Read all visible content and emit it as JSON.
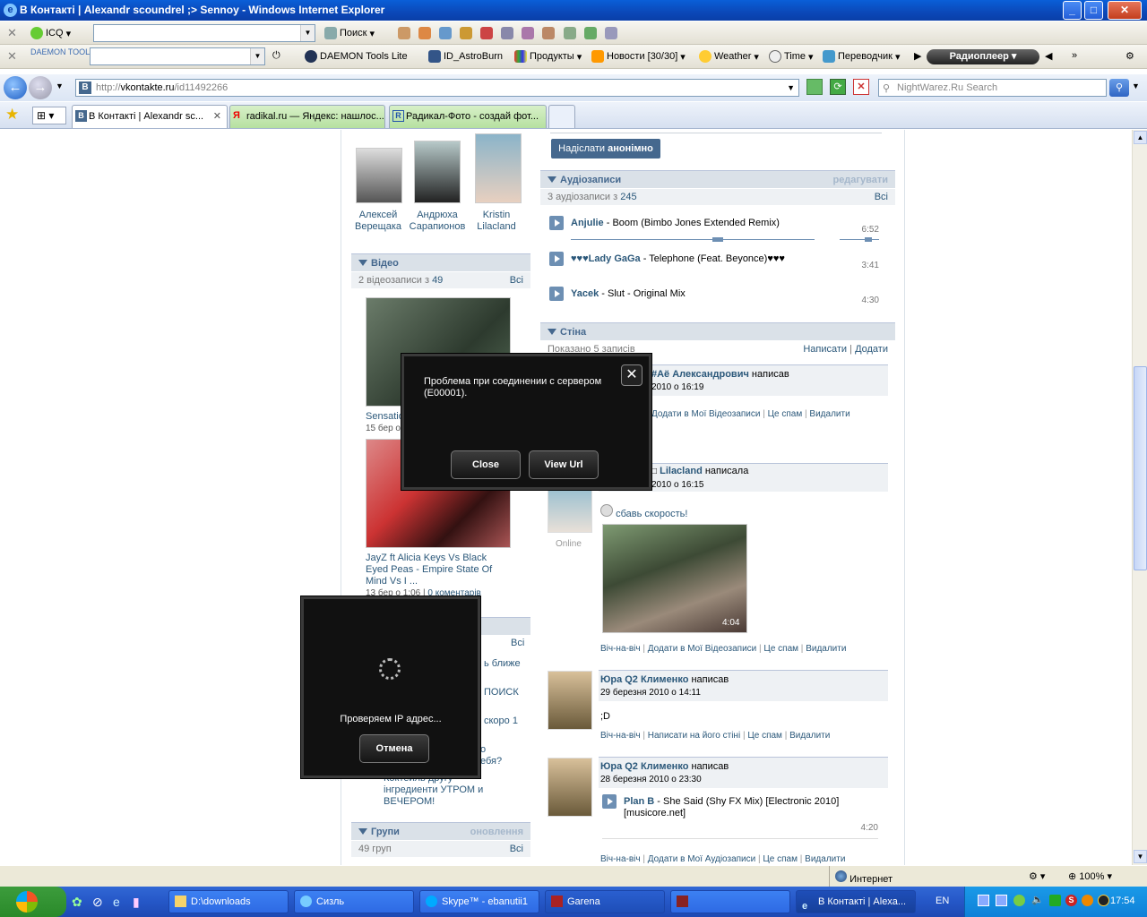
{
  "window": {
    "title": "В Контакті | Alexandr scoundrel ;> Sennoy - Windows Internet Explorer"
  },
  "toolbar1": {
    "icq": "ICQ",
    "search": "Поиск"
  },
  "toolbar2": {
    "daemon_logo": "DAEMON TOOLS",
    "items": [
      "DAEMON Tools Lite",
      "ID_AstroBurn",
      "Продукты",
      "Новости [30/30]",
      "Weather",
      "Time",
      "Переводчик"
    ],
    "radio": "Радиоплеер"
  },
  "address": {
    "url_prefix": "http://",
    "url_host": "vkontakte.ru",
    "url_path": "/id11492266",
    "search_placeholder": "NightWarez.Ru Search"
  },
  "tabs": [
    {
      "label": "В Контакті | Alexandr sc..."
    },
    {
      "label": "radikal.ru — Яндекс: нашлос..."
    },
    {
      "label": "Радикал-Фото - создай фот..."
    }
  ],
  "friends": [
    {
      "first": "Алексей",
      "last": "Верещака"
    },
    {
      "first": "Андрюха",
      "last": "Сарапионов"
    },
    {
      "first": "Kristin",
      "last": "Lilacland"
    }
  ],
  "video": {
    "header": "Відео",
    "count_text": "2 відеозаписи з",
    "count_total": "49",
    "all": "Всі",
    "item1_title_partial": "Sensatio",
    "item1_date_partial": "15 бер о",
    "item2_title": "JayZ ft Alicia Keys Vs Black Eyed Peas - Empire State Of Mind Vs I ...",
    "item2_date": "13 бер о 1:06",
    "item2_comments": "0 коментарів"
  },
  "left_lower": {
    "all": "Всі",
    "snippet1": "ь ближе",
    "snippet2": "ПОИСК",
    "snippet3": "скоро 1",
    "snippet4": "о",
    "snippet5": "ебя?",
    "snippet6": "Коктейль другу -",
    "snippet7": "інгредиенти УТРОМ и",
    "snippet8": "ВЕЧЕРОМ!"
  },
  "groups": {
    "header": "Групи",
    "updates": "оновлення",
    "count": "49 груп",
    "all": "Всі"
  },
  "anon_button": {
    "prefix": "Надіслати",
    "bold": "анонімно"
  },
  "audio": {
    "header": "Аудіозаписи",
    "edit": "редагувати",
    "count_text": "3 аудіозаписи з",
    "count_total": "245",
    "all": "Всі",
    "tracks": [
      {
        "artist": "Anjulie",
        "title": "- Boom (Bimbo Jones Extended Remix)",
        "duration": "6:52"
      },
      {
        "artist": "♥♥♥Lady GaGa",
        "title": "- Telephone (Feat. Beyonce)♥♥♥",
        "duration": "3:41"
      },
      {
        "artist": "Yacek",
        "title": "- Slut - Original Mix",
        "duration": "4:30"
      }
    ]
  },
  "wall": {
    "header": "Стіна",
    "shown": "Показано 5 записів",
    "write": "Написати",
    "add": "Додати",
    "posts": [
      {
        "author": "#Аё Александрович",
        "verb": "написав",
        "date": "2010 о 16:19",
        "actions": [
          "Додати в Мої Відеозаписи",
          "Це спам",
          "Видалити"
        ]
      },
      {
        "author": "Lilacland",
        "verb": "написала",
        "date": "2010 о 16:15",
        "status": "Online",
        "text": "сбавь скорость!",
        "video_duration": "4:04",
        "actions": [
          "Віч-на-віч",
          "Додати в Мої Відеозаписи",
          "Це спам",
          "Видалити"
        ]
      },
      {
        "author": "Юра Q2 Клименко",
        "verb": "написав",
        "date": "29 березня 2010 о 14:11",
        "text": ";D",
        "actions": [
          "Віч-на-віч",
          "Написати на його стіні",
          "Це спам",
          "Видалити"
        ]
      },
      {
        "author": "Юра Q2 Клименко",
        "verb": "написав",
        "date": "28 березня 2010 о 23:30",
        "track_artist": "Plan B",
        "track_title": "- She Said (Shy FX Mix) [Electronic 2010] [musicore.net]",
        "track_duration": "4:20",
        "actions": [
          "Віч-на-віч",
          "Додати в Мої Аудіозаписи",
          "Це спам",
          "Видалити"
        ]
      }
    ]
  },
  "error_dialog": {
    "message": "Проблема при соединении с сервером (E00001).",
    "close": "Close",
    "view_url": "View Url"
  },
  "ip_dialog": {
    "message": "Проверяем IP адрес...",
    "cancel": "Отмена"
  },
  "status": {
    "zone": "Интернет",
    "zoom": "100%"
  },
  "taskbar": {
    "tasks": [
      "D:\\downloads",
      "Сизль",
      "Skype™ - ebanutii1",
      "Garena",
      "",
      "В Контакті | Alexa..."
    ],
    "lang": "EN",
    "time": "17:54"
  },
  "colors": {
    "vk_header_bg": "#dae1e8",
    "vk_link": "#2b587a",
    "xp_blue": "#245ed8"
  }
}
